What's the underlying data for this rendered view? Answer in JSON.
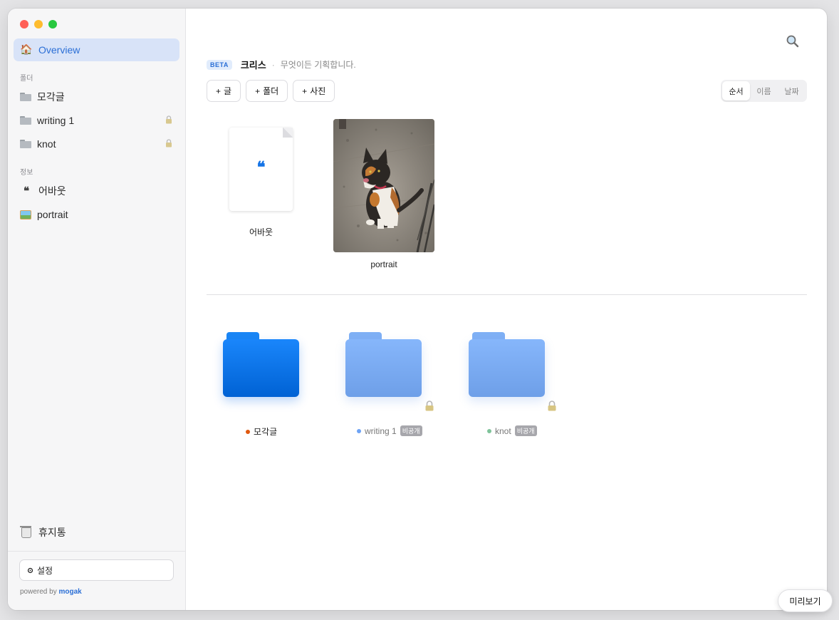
{
  "sidebar": {
    "overview_label": "Overview",
    "folders_heading": "폴더",
    "folders": [
      {
        "label": "모각글",
        "locked": false
      },
      {
        "label": "writing 1",
        "locked": true
      },
      {
        "label": "knot",
        "locked": true
      }
    ],
    "info_heading": "정보",
    "info_items": [
      {
        "label": "어바웃",
        "icon": "quote-icon"
      },
      {
        "label": "portrait",
        "icon": "picture-icon"
      }
    ],
    "trash_label": "휴지통",
    "settings_label": "설정",
    "powered_prefix": "powered by",
    "powered_brand": "mogak"
  },
  "header": {
    "beta": "BETA",
    "title": "크리스",
    "separator": "·",
    "tagline": "무엇이든 기획합니다."
  },
  "actions": {
    "post": "글",
    "folder": "폴더",
    "photo": "사진"
  },
  "sort": {
    "options": [
      "순서",
      "이름",
      "날짜"
    ],
    "active": "순서"
  },
  "items": {
    "about_caption": "어바웃",
    "portrait_caption": "portrait"
  },
  "folders_grid": [
    {
      "label": "모각글",
      "dot_color": "#e0580e",
      "private": false
    },
    {
      "label": "writing 1",
      "dot_color": "#6ea3f5",
      "private": true,
      "badge": "비공개"
    },
    {
      "label": "knot",
      "dot_color": "#7fc39a",
      "private": true,
      "badge": "비공개"
    }
  ],
  "preview_label": "미리보기",
  "colors": {
    "accent": "#2b6fd6",
    "folder_primary": "#0a75ec",
    "folder_light": "#7fb0f5"
  }
}
